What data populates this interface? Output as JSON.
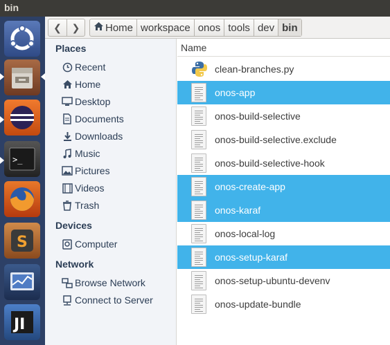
{
  "window": {
    "title": "bin"
  },
  "launcher": {
    "items": [
      {
        "name": "ubuntu-dash-icon",
        "color": "#3f5a95"
      },
      {
        "name": "files-app-icon",
        "color": "#8a4a2f"
      },
      {
        "name": "eclipse-app-icon",
        "color": "#e05a1a"
      },
      {
        "name": "terminal-app-icon",
        "color": "#2a2a2a"
      },
      {
        "name": "firefox-app-icon",
        "color": "#d04f16"
      },
      {
        "name": "sublime-text-app-icon",
        "color": "#b8652a"
      },
      {
        "name": "system-monitor-app-icon",
        "color": "#24375c"
      },
      {
        "name": "intellij-app-icon",
        "color": "#3a66a8"
      }
    ]
  },
  "toolbar": {
    "back_icon": "chevron-left-icon",
    "forward_icon": "chevron-right-icon",
    "breadcrumbs": [
      "Home",
      "workspace",
      "onos",
      "tools",
      "dev",
      "bin"
    ]
  },
  "sidebar": {
    "places_label": "Places",
    "places": [
      {
        "label": "Recent",
        "icon": "clock-icon"
      },
      {
        "label": "Home",
        "icon": "home-icon"
      },
      {
        "label": "Desktop",
        "icon": "desktop-icon"
      },
      {
        "label": "Documents",
        "icon": "documents-icon"
      },
      {
        "label": "Downloads",
        "icon": "downloads-icon"
      },
      {
        "label": "Music",
        "icon": "music-icon"
      },
      {
        "label": "Pictures",
        "icon": "pictures-icon"
      },
      {
        "label": "Videos",
        "icon": "videos-icon"
      },
      {
        "label": "Trash",
        "icon": "trash-icon"
      }
    ],
    "devices_label": "Devices",
    "devices": [
      {
        "label": "Computer",
        "icon": "computer-icon"
      }
    ],
    "network_label": "Network",
    "network": [
      {
        "label": "Browse Network",
        "icon": "network-icon"
      },
      {
        "label": "Connect to Server",
        "icon": "server-icon"
      }
    ]
  },
  "main": {
    "column_header": "Name",
    "files": [
      {
        "name": "clean-branches.py",
        "type": "python",
        "selected": false
      },
      {
        "name": "onos-app",
        "type": "script",
        "selected": true
      },
      {
        "name": "onos-build-selective",
        "type": "script",
        "selected": false
      },
      {
        "name": "onos-build-selective.exclude",
        "type": "text",
        "selected": false
      },
      {
        "name": "onos-build-selective-hook",
        "type": "script",
        "selected": false
      },
      {
        "name": "onos-create-app",
        "type": "script",
        "selected": true
      },
      {
        "name": "onos-karaf",
        "type": "script",
        "selected": true
      },
      {
        "name": "onos-local-log",
        "type": "script",
        "selected": false
      },
      {
        "name": "onos-setup-karaf",
        "type": "script",
        "selected": true
      },
      {
        "name": "onos-setup-ubuntu-devenv",
        "type": "script",
        "selected": false
      },
      {
        "name": "onos-update-bundle",
        "type": "script",
        "selected": false
      }
    ],
    "selection_color": "#41b3ea"
  }
}
